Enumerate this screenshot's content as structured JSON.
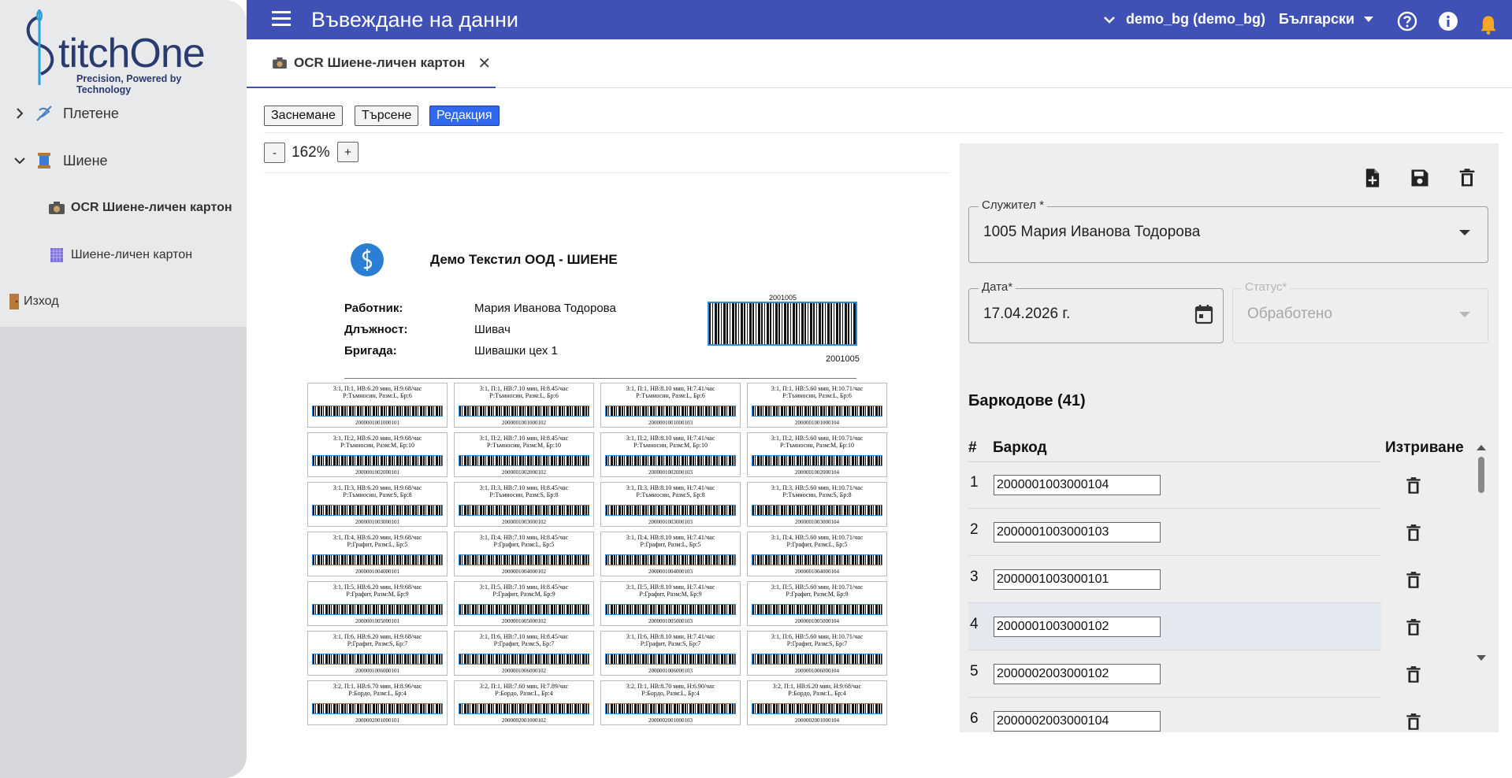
{
  "sidebar": {
    "logo": {
      "text": "titchOne",
      "tagline": "Precision, Powered by Technology"
    },
    "items": [
      {
        "label": "Плетене"
      },
      {
        "label": "Шиене"
      },
      {
        "label": "OCR Шиене-личен картон"
      },
      {
        "label": "Шиене-личен картон"
      },
      {
        "label": "Изход"
      }
    ]
  },
  "topbar": {
    "title": "Въвеждане на данни",
    "account": "demo_bg (demo_bg)",
    "language": "Български"
  },
  "tab": {
    "label": "OCR Шиене-личен картон"
  },
  "modes": {
    "capture": "Заснемане",
    "search": "Търсене",
    "edit": "Редакция"
  },
  "zoom": {
    "minus": "-",
    "value": "162%",
    "plus": "+"
  },
  "document": {
    "company": "Демо Текстил ООД - ШИЕНЕ",
    "worker_label": "Работник:",
    "worker_value": "Мария Иванова Тодорова",
    "position_label": "Длъжност:",
    "position_value": "Шивач",
    "brigade_label": "Бригада:",
    "brigade_value": "Шивашки цех 1",
    "code_top": "2001005",
    "code_bottom": "2001005",
    "labels": [
      {
        "l1": "3:1, П:1, НВ:6.20 мин, Н:9.68/час",
        "l2": "Р:Тъмносин, Разм:L, Бр:6",
        "num": "2000001001000101"
      },
      {
        "l1": "3:1, П:1, НВ:7.10 мин, Н:8.45/час",
        "l2": "Р:Тъмносин, Разм:L, Бр:6",
        "num": "2000001001000102"
      },
      {
        "l1": "3:1, П:1, НВ:8.10 мин, Н:7.41/час",
        "l2": "Р:Тъмносин, Разм:L, Бр:6",
        "num": "2000001001000103"
      },
      {
        "l1": "3:1, П:1, НВ:5.60 мин, Н:10.71/час",
        "l2": "Р:Тъмносин, Разм:L, Бр:6",
        "num": "2000001001000104"
      },
      {
        "l1": "3:1, П:2, НВ:6.20 мин, Н:9.68/час",
        "l2": "Р:Тъмносин, Разм:M, Бр:10",
        "num": "2000001002000101"
      },
      {
        "l1": "3:1, П:2, НВ:7.10 мин, Н:8.45/час",
        "l2": "Р:Тъмносин, Разм:M, Бр:10",
        "num": "2000001002000102"
      },
      {
        "l1": "3:1, П:2, НВ:8.10 мин, Н:7.41/час",
        "l2": "Р:Тъмносин, Разм:M, Бр:10",
        "num": "2000001002000103"
      },
      {
        "l1": "3:1, П:2, НВ:5.60 мин, Н:10.71/час",
        "l2": "Р:Тъмносин, Разм:M, Бр:10",
        "num": "2000001002000104"
      },
      {
        "l1": "3:1, П:3, НВ:6.20 мин, Н:9.68/час",
        "l2": "Р:Тъмносин, Разм:S, Бр:8",
        "num": "2000001003000101"
      },
      {
        "l1": "3:1, П:3, НВ:7.10 мин, Н:8.45/час",
        "l2": "Р:Тъмносин, Разм:S, Бр:8",
        "num": "2000001003000102"
      },
      {
        "l1": "3:1, П:3, НВ:8.10 мин, Н:7.41/час",
        "l2": "Р:Тъмносин, Разм:S, Бр:8",
        "num": "2000001003000103"
      },
      {
        "l1": "3:1, П:3, НВ:5.60 мин, Н:10.71/час",
        "l2": "Р:Тъмносин, Разм:S, Бр:8",
        "num": "2000001003000104"
      },
      {
        "l1": "3:1, П:4, НВ:6.20 мин, Н:9.68/час",
        "l2": "Р:Графит, Разм:L, Бр:5",
        "num": "2000001004000101"
      },
      {
        "l1": "3:1, П:4, НВ:7.10 мин, Н:8.45/час",
        "l2": "Р:Графит, Разм:L, Бр:5",
        "num": "2000001004000102"
      },
      {
        "l1": "3:1, П:4, НВ:8.10 мин, Н:7.41/час",
        "l2": "Р:Графит, Разм:L, Бр:5",
        "num": "2000001004000103"
      },
      {
        "l1": "3:1, П:4, НВ:5.60 мин, Н:10.71/час",
        "l2": "Р:Графит, Разм:L, Бр:5",
        "num": "2000001004000104"
      },
      {
        "l1": "3:1, П:5, НВ:6.20 мин, Н:9.68/час",
        "l2": "Р:Графит, Разм:M, Бр:9",
        "num": "2000001005000101"
      },
      {
        "l1": "3:1, П:5, НВ:7.10 мин, Н:8.45/час",
        "l2": "Р:Графит, Разм:M, Бр:9",
        "num": "2000001005000102"
      },
      {
        "l1": "3:1, П:5, НВ:8.10 мин, Н:7.41/час",
        "l2": "Р:Графит, Разм:M, Бр:9",
        "num": "2000001005000103"
      },
      {
        "l1": "3:1, П:5, НВ:5.60 мин, Н:10.71/час",
        "l2": "Р:Графит, Разм:M, Бр:9",
        "num": "2000001005000104"
      },
      {
        "l1": "3:1, П:6, НВ:6.20 мин, Н:9.68/час",
        "l2": "Р:Графит, Разм:S, Бр:7",
        "num": "2000001006000101"
      },
      {
        "l1": "3:1, П:6, НВ:7.10 мин, Н:8.45/час",
        "l2": "Р:Графит, Разм:S, Бр:7",
        "num": "2000001006000102"
      },
      {
        "l1": "3:1, П:6, НВ:8.10 мин, Н:7.41/час",
        "l2": "Р:Графит, Разм:S, Бр:7",
        "num": "2000001006000103"
      },
      {
        "l1": "3:1, П:6, НВ:5.60 мин, Н:10.71/час",
        "l2": "Р:Графит, Разм:S, Бр:7",
        "num": "2000001006000104"
      },
      {
        "l1": "3:2, П:1, НВ:6.70 мин, Н:8.96/час",
        "l2": "Р:Бордо, Разм:L, Бр:4",
        "num": "2000002001000101"
      },
      {
        "l1": "3:2, П:1, НВ:7.60 мин, Н:7.89/час",
        "l2": "Р:Бордо, Разм:L, Бр:4",
        "num": "2000002001000102"
      },
      {
        "l1": "3:2, П:1, НВ:8.70 мин, Н:6.90/час",
        "l2": "Р:Бордо, Разм:L, Бр:4",
        "num": "2000002001000103"
      },
      {
        "l1": "3:2, П:1, НВ:6.20 мин, Н:9.68/час",
        "l2": "Р:Бордо, Разм:L, Бр:4",
        "num": "2000002001000104"
      }
    ]
  },
  "form": {
    "employee_label": "Служител *",
    "employee_value": "1005 Мария Иванова Тодорова",
    "date_label": "Дата*",
    "date_value": "17.04.2026 г.",
    "status_label": "Статус*",
    "status_value": "Обработено"
  },
  "barcodes": {
    "title": "Баркодове (41)",
    "col_num": "#",
    "col_code": "Баркод",
    "col_delete": "Изтриване",
    "rows": [
      {
        "n": "1",
        "code": "2000001003000104"
      },
      {
        "n": "2",
        "code": "2000001003000103"
      },
      {
        "n": "3",
        "code": "2000001003000101"
      },
      {
        "n": "4",
        "code": "2000001003000102"
      },
      {
        "n": "5",
        "code": "2000002003000102"
      },
      {
        "n": "6",
        "code": "2000002003000104"
      }
    ]
  },
  "colors": {
    "primary": "#3f51b5",
    "active_button": "#3068f0"
  }
}
